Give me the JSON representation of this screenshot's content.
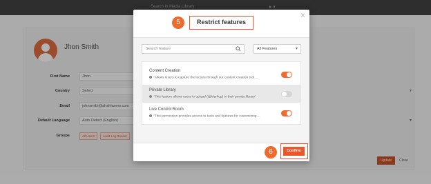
{
  "topbar": {
    "search_text": "Search in Media Library",
    "icons": [
      "user-icon",
      "chevron-down-icon"
    ]
  },
  "profile": {
    "name": "Jhon Smith"
  },
  "form": {
    "first_name": {
      "label": "First Name",
      "value": "Jhon"
    },
    "country": {
      "label": "Country",
      "value": "Select"
    },
    "email": {
      "label": "Email",
      "value": "johnsmith@ahahlasers.com"
    },
    "default_language": {
      "label": "Default Language",
      "value": "Auto Detect (English)"
    },
    "groups": {
      "label": "Groups",
      "tags": [
        "All Users",
        "Audit Log Reader"
      ]
    }
  },
  "page_buttons": {
    "update": "Update",
    "close": "Close"
  },
  "modal": {
    "step_title": "5",
    "title": "Restrict features",
    "close_symbol": "×",
    "search_placeholder": "Search feature",
    "filter_selected": "All Features",
    "features": [
      {
        "title": "Content Creation",
        "description": "\"Allows Users to capture the lecture through our content creation tool....",
        "enabled": true,
        "disabled_row": false
      },
      {
        "title": "Private Library",
        "description": "\"This feature allows users to upload (@Markup) in their private library\"",
        "enabled": false,
        "disabled_row": true
      },
      {
        "title": "Live Control Room",
        "description": "\"This permission provides access to tools and features for customizing....",
        "enabled": true,
        "disabled_row": false
      }
    ],
    "step_confirm": "6",
    "confirm_label": "Confirm"
  },
  "colors": {
    "accent": "#ef6a2c",
    "highlight_border": "#e4572e",
    "topbar": "#3c3c3c"
  }
}
